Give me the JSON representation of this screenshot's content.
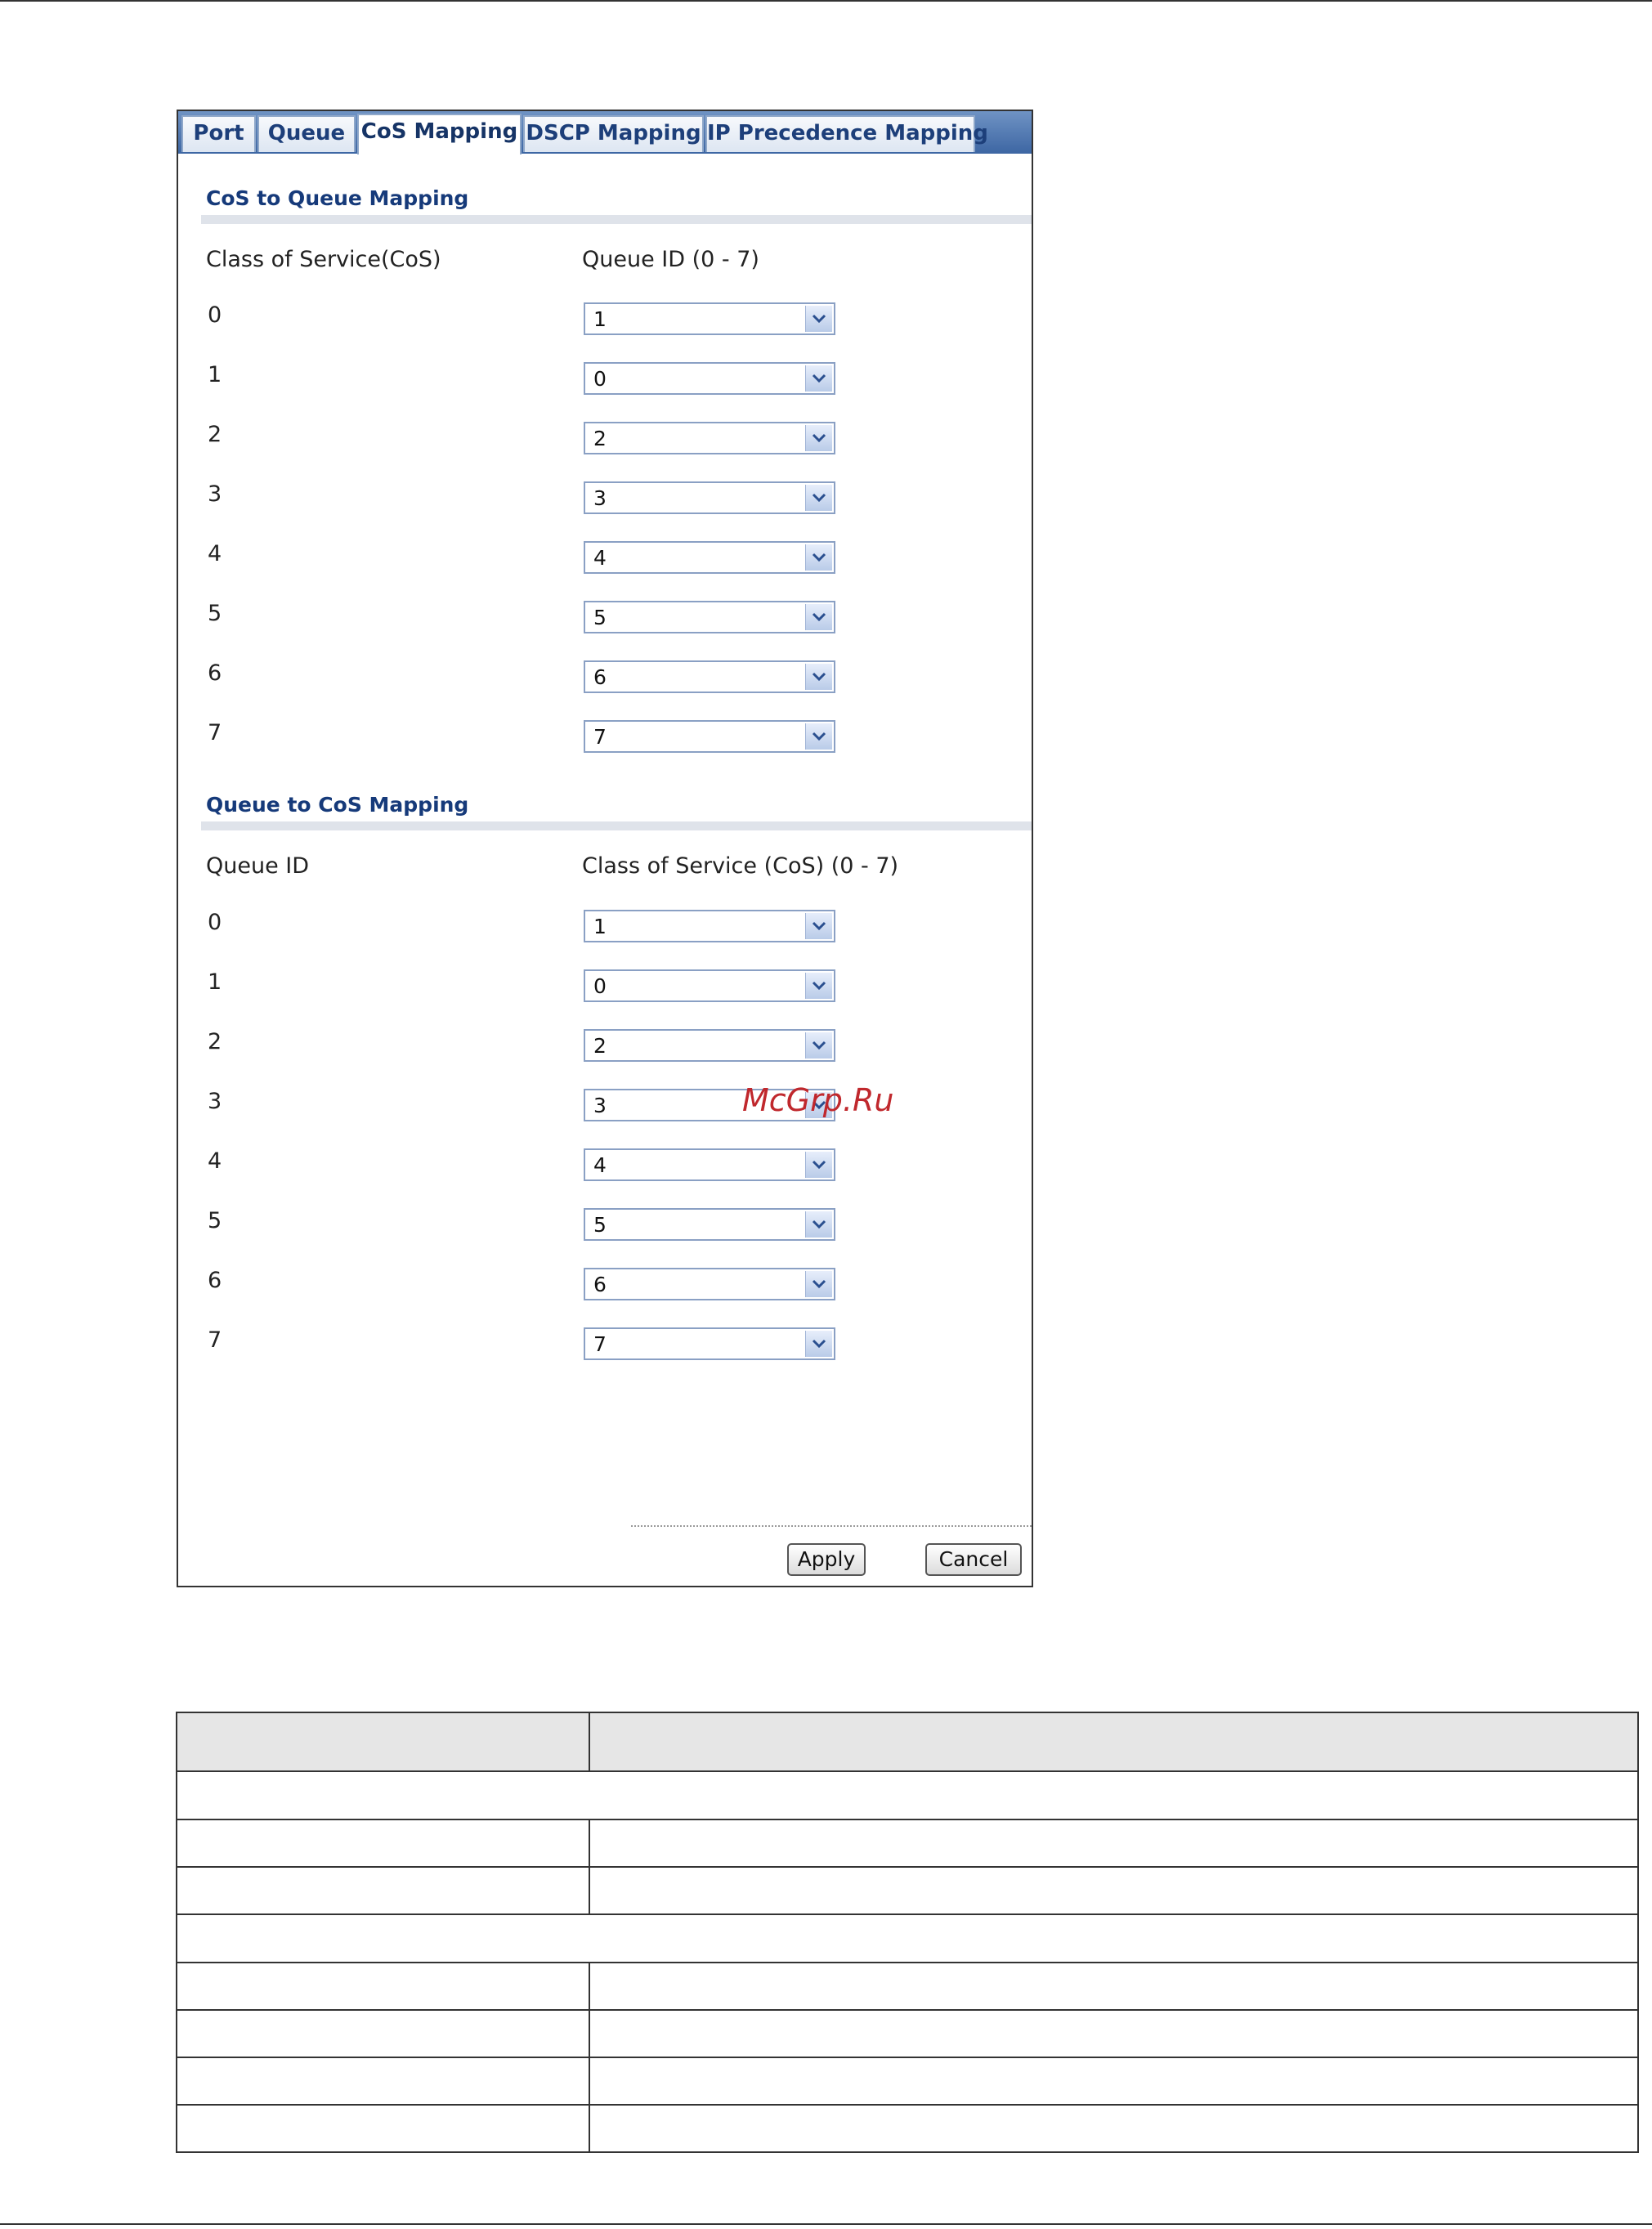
{
  "tabs": [
    {
      "label": "Port"
    },
    {
      "label": "Queue"
    },
    {
      "label": "CoS Mapping"
    },
    {
      "label": "DSCP Mapping"
    },
    {
      "label": "IP Precedence Mapping"
    }
  ],
  "cos_to_queue": {
    "title": "CoS to Queue Mapping",
    "col1": "Class of Service(CoS)",
    "col2": "Queue ID (0 - 7)",
    "rows": [
      {
        "label": "0",
        "value": "1"
      },
      {
        "label": "1",
        "value": "0"
      },
      {
        "label": "2",
        "value": "2"
      },
      {
        "label": "3",
        "value": "3"
      },
      {
        "label": "4",
        "value": "4"
      },
      {
        "label": "5",
        "value": "5"
      },
      {
        "label": "6",
        "value": "6"
      },
      {
        "label": "7",
        "value": "7"
      }
    ]
  },
  "queue_to_cos": {
    "title": "Queue to CoS Mapping",
    "col1": "Queue ID",
    "col2": "Class of Service (CoS) (0 - 7)",
    "rows": [
      {
        "label": "0",
        "value": "1"
      },
      {
        "label": "1",
        "value": "0"
      },
      {
        "label": "2",
        "value": "2"
      },
      {
        "label": "3",
        "value": "3"
      },
      {
        "label": "4",
        "value": "4"
      },
      {
        "label": "5",
        "value": "5"
      },
      {
        "label": "6",
        "value": "6"
      },
      {
        "label": "7",
        "value": "7"
      }
    ]
  },
  "buttons": {
    "apply": "Apply",
    "cancel": "Cancel"
  },
  "watermark": "McGrp.Ru",
  "colors": {
    "tabbar": "#3d66a3",
    "section_title": "#163a7a",
    "watermark": "#c0282d"
  }
}
